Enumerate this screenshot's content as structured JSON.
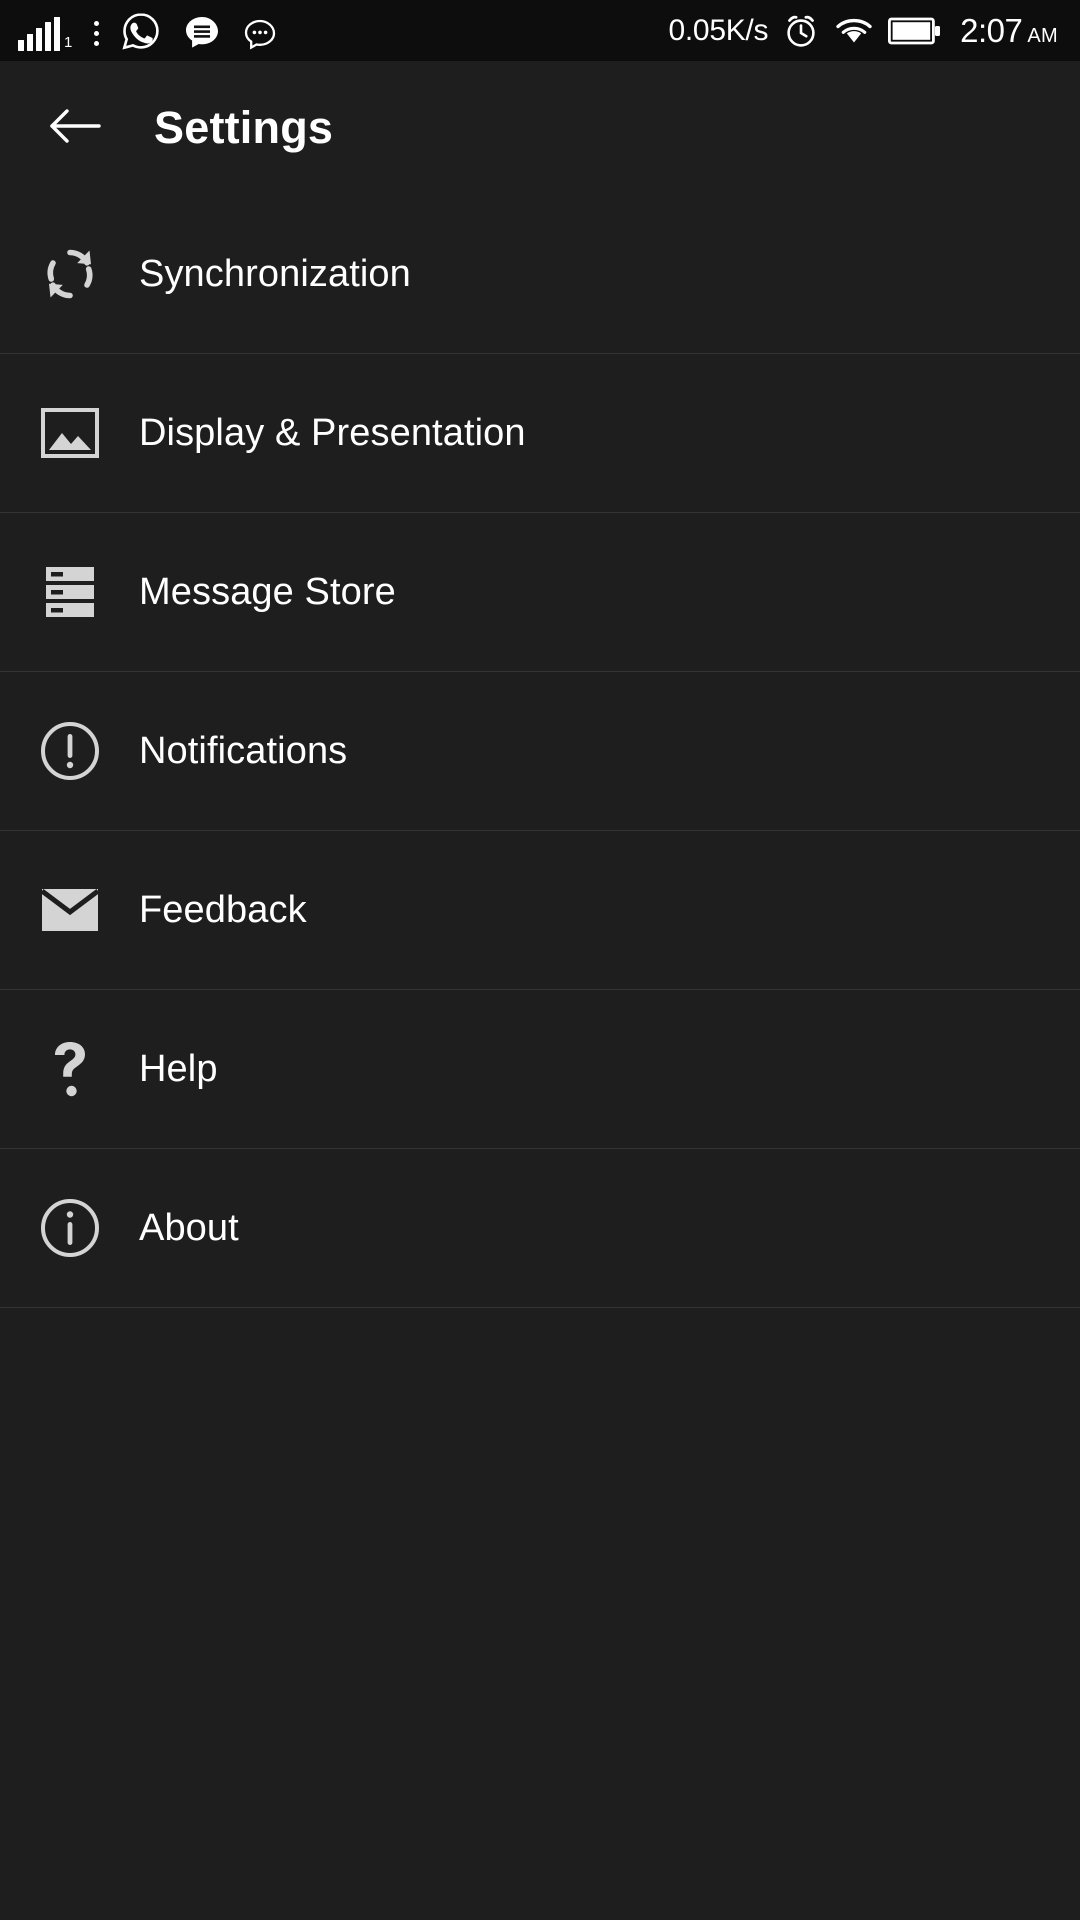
{
  "statusbar": {
    "signal_sim_label": "1",
    "network_speed": "0.05K/s",
    "time": "2:07",
    "ampm": "AM",
    "icons": {
      "signal": "signal-bars-icon",
      "overflow": "three-dot-menu-icon",
      "whatsapp": "whatsapp-icon",
      "messages": "message-bubble-icon",
      "chat": "chat-dots-icon",
      "alarm": "alarm-clock-icon",
      "wifi": "wifi-icon",
      "battery": "battery-full-icon"
    }
  },
  "appbar": {
    "back_label": "back-arrow",
    "title": "Settings"
  },
  "settings_list": [
    {
      "label": "Synchronization",
      "icon": "sync-icon"
    },
    {
      "label": "Display & Presentation",
      "icon": "image-icon"
    },
    {
      "label": "Message Store",
      "icon": "storage-icon"
    },
    {
      "label": "Notifications",
      "icon": "alert-circle-icon"
    },
    {
      "label": "Feedback",
      "icon": "envelope-icon"
    },
    {
      "label": "Help",
      "icon": "question-mark-icon"
    },
    {
      "label": "About",
      "icon": "info-circle-icon"
    }
  ],
  "colors": {
    "background": "#1e1e1e",
    "statusbar_background": "#0d0d0d",
    "divider": "#343434",
    "icon": "#d4d4d4",
    "text": "#ffffff"
  }
}
